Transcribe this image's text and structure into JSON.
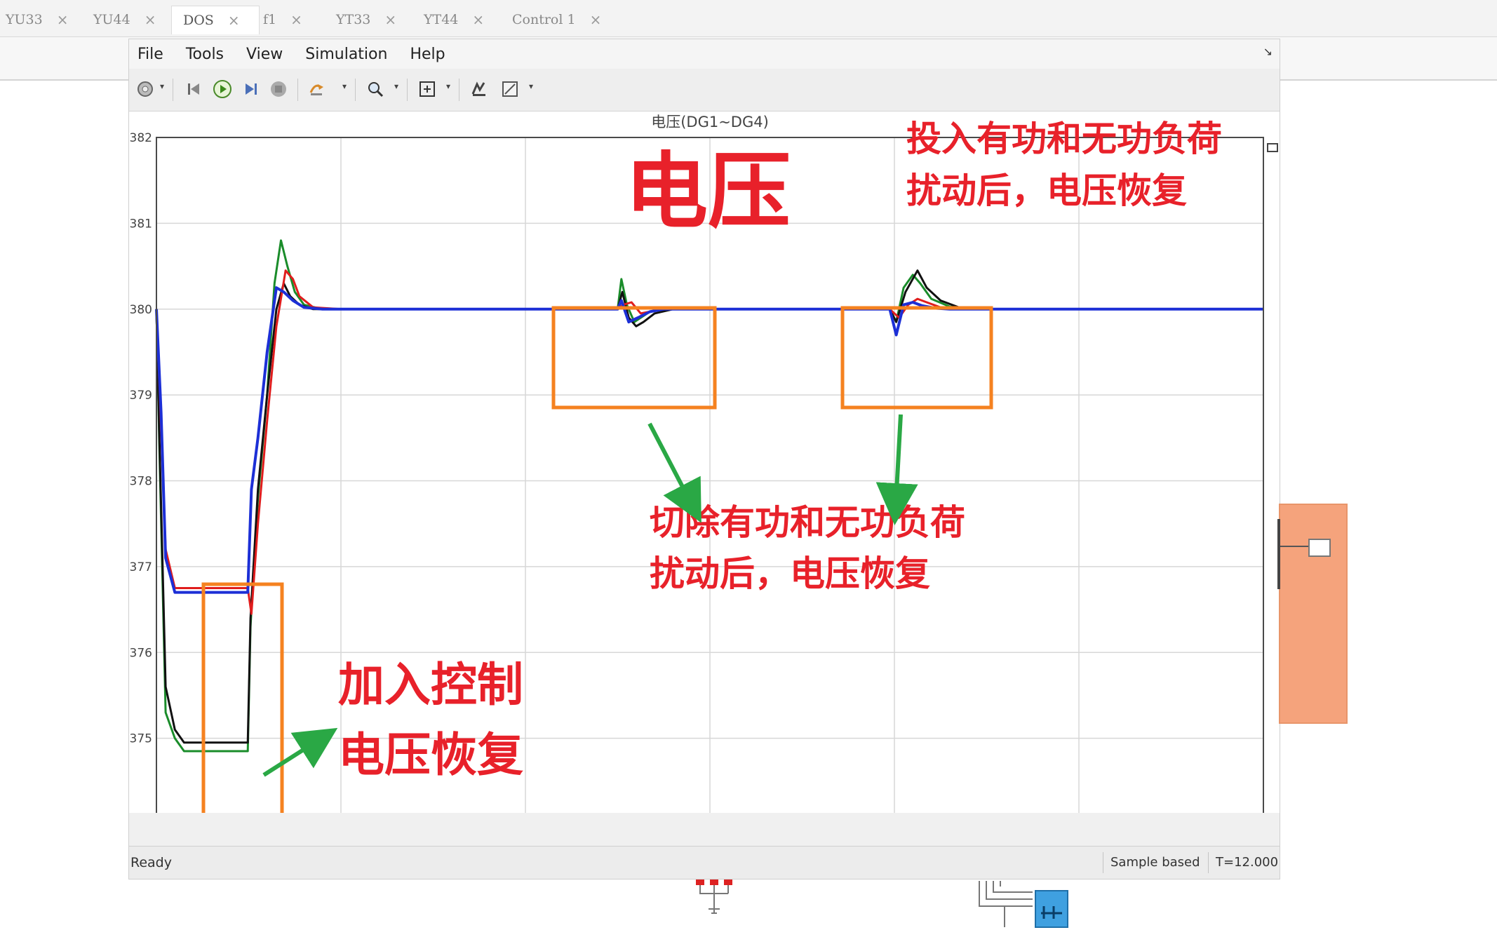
{
  "tabs": [
    {
      "label": "YU33",
      "active": false
    },
    {
      "label": "YU44",
      "active": false
    },
    {
      "label": "DOS",
      "active": true
    },
    {
      "label": "f1",
      "active": false
    },
    {
      "label": "YT33",
      "active": false
    },
    {
      "label": "YT44",
      "active": false
    },
    {
      "label": "Control 1",
      "active": false
    }
  ],
  "tab_close_glyph": "×",
  "menu": [
    "File",
    "Tools",
    "View",
    "Simulation",
    "Help"
  ],
  "menu_arrow_icon": "pin-icon",
  "toolbar_icons": [
    "settings-icon",
    "step-back-icon",
    "run-icon",
    "step-forward-icon",
    "stop-icon",
    "highlight-icon",
    "zoom-icon",
    "fit-view-icon",
    "triggers-icon",
    "measure-icon"
  ],
  "plot": {
    "subtitle": "电压(DG1~DG4)",
    "big_label": "电压",
    "annotation_top_right": [
      "投入有功和无功负荷",
      "扰动后，电压恢复"
    ],
    "annotation_middle": [
      "切除有功和无功负荷",
      "扰动后，电压恢复"
    ],
    "annotation_bottom_left": [
      "加入控制",
      "电压恢复"
    ],
    "colors": {
      "annotation": "#e8212a",
      "box": "#f58220",
      "arrow": "#2aa845",
      "grid": "#d7d7d7"
    }
  },
  "chart_data": {
    "type": "line",
    "title": "电压(DG1~DG4)",
    "xlim": [
      0,
      12
    ],
    "ylim": [
      374,
      382
    ],
    "xticks": [
      0,
      2,
      4,
      6,
      8,
      10,
      12
    ],
    "yticks": [
      374,
      375,
      376,
      377,
      378,
      379,
      380,
      381,
      382
    ],
    "grid": true,
    "series": [
      {
        "color": "#1a8c2a",
        "x": [
          0,
          0.03,
          0.1,
          0.2,
          0.3,
          0.5,
          0.99,
          1.02,
          1.1,
          1.2,
          1.28,
          1.35,
          1.42,
          1.5,
          1.6,
          1.8,
          2.2,
          5.0,
          5.04,
          5.1,
          5.18,
          5.25,
          5.35,
          5.5,
          5.7,
          6,
          7.95,
          8.02,
          8.1,
          8.2,
          8.28,
          8.4,
          8.6,
          8.9,
          12
        ],
        "y": [
          380,
          378.5,
          375.3,
          375.0,
          374.85,
          374.85,
          374.85,
          376.3,
          377.8,
          379.0,
          380.3,
          380.8,
          380.5,
          380.2,
          380.05,
          380.0,
          380.0,
          380.0,
          380.35,
          380.05,
          379.85,
          379.9,
          379.97,
          380.0,
          380.0,
          380.0,
          380.0,
          379.85,
          380.25,
          380.4,
          380.3,
          380.12,
          380.03,
          380.0,
          380.0
        ]
      },
      {
        "color": "#111111",
        "x": [
          0,
          0.03,
          0.1,
          0.2,
          0.3,
          0.5,
          0.99,
          1.02,
          1.1,
          1.2,
          1.3,
          1.38,
          1.45,
          1.55,
          1.7,
          2.0,
          5.0,
          5.05,
          5.12,
          5.2,
          5.28,
          5.4,
          5.6,
          6,
          7.95,
          8.02,
          8.12,
          8.25,
          8.35,
          8.5,
          8.7,
          9,
          12
        ],
        "y": [
          380,
          378.6,
          375.6,
          375.1,
          374.95,
          374.95,
          374.95,
          376.4,
          377.9,
          379.0,
          380.0,
          380.3,
          380.15,
          380.05,
          380.0,
          380.0,
          380.0,
          380.2,
          379.9,
          379.8,
          379.85,
          379.95,
          380.0,
          380.0,
          380.0,
          379.85,
          380.2,
          380.45,
          380.25,
          380.1,
          380.02,
          380.0,
          380.0
        ]
      },
      {
        "color": "#e01d1d",
        "x": [
          0,
          0.04,
          0.1,
          0.2,
          0.5,
          0.99,
          1.03,
          1.1,
          1.2,
          1.3,
          1.4,
          1.48,
          1.55,
          1.7,
          2.0,
          5.0,
          5.06,
          5.15,
          5.25,
          5.35,
          5.5,
          5.7,
          6,
          7.95,
          8.05,
          8.15,
          8.25,
          8.35,
          8.5,
          8.7,
          9,
          12
        ],
        "y": [
          380,
          378.9,
          377.2,
          376.75,
          376.75,
          376.75,
          376.45,
          377.5,
          378.7,
          379.8,
          380.45,
          380.35,
          380.15,
          380.02,
          380.0,
          380.0,
          380.05,
          380.08,
          379.95,
          379.97,
          380.0,
          380.0,
          380.0,
          380.0,
          379.9,
          380.05,
          380.12,
          380.08,
          380.02,
          380.0,
          380.0,
          380.0
        ]
      },
      {
        "color": "#1c2fd6",
        "x": [
          0,
          0.05,
          0.1,
          0.2,
          0.5,
          0.99,
          1.03,
          1.1,
          1.2,
          1.3,
          1.38,
          1.48,
          1.6,
          1.8,
          2.0,
          5.0,
          5.04,
          5.12,
          5.22,
          5.35,
          5.5,
          5.7,
          6,
          7.95,
          8.02,
          8.1,
          8.2,
          8.3,
          8.45,
          8.6,
          9,
          12
        ],
        "y": [
          380,
          378.8,
          377.1,
          376.7,
          376.7,
          376.7,
          377.9,
          378.5,
          379.5,
          380.25,
          380.2,
          380.1,
          380.02,
          380.0,
          380.0,
          380.0,
          380.1,
          379.85,
          379.9,
          379.97,
          380.0,
          380.0,
          380.0,
          380.0,
          379.7,
          380.05,
          380.08,
          380.04,
          380.01,
          380.0,
          380.0,
          380.0
        ]
      }
    ]
  },
  "status": {
    "ready": "Ready",
    "mode": "Sample based",
    "time": "T=12.000"
  }
}
